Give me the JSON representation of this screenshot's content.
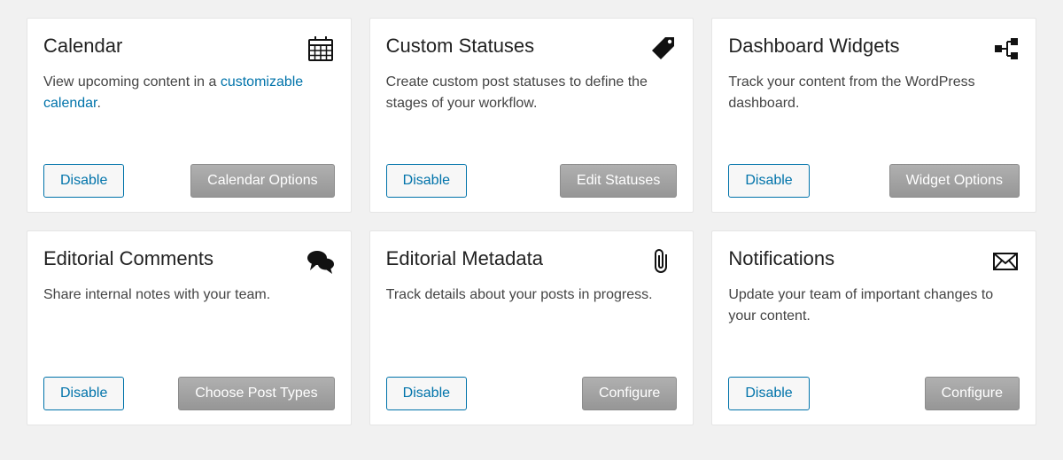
{
  "cards": [
    {
      "title": "Calendar",
      "desc_prefix": "View upcoming content in a ",
      "desc_link": "customizable calendar",
      "desc_suffix": ".",
      "disable_label": "Disable",
      "config_label": "Calendar Options"
    },
    {
      "title": "Custom Statuses",
      "desc": "Create custom post statuses to define the stages of your workflow.",
      "disable_label": "Disable",
      "config_label": "Edit Statuses"
    },
    {
      "title": "Dashboard Widgets",
      "desc": "Track your content from the WordPress dashboard.",
      "disable_label": "Disable",
      "config_label": "Widget Options"
    },
    {
      "title": "Editorial Comments",
      "desc": "Share internal notes with your team.",
      "disable_label": "Disable",
      "config_label": "Choose Post Types"
    },
    {
      "title": "Editorial Metadata",
      "desc": "Track details about your posts in progress.",
      "disable_label": "Disable",
      "config_label": "Configure"
    },
    {
      "title": "Notifications",
      "desc": "Update your team of important changes to your content.",
      "disable_label": "Disable",
      "config_label": "Configure"
    }
  ]
}
